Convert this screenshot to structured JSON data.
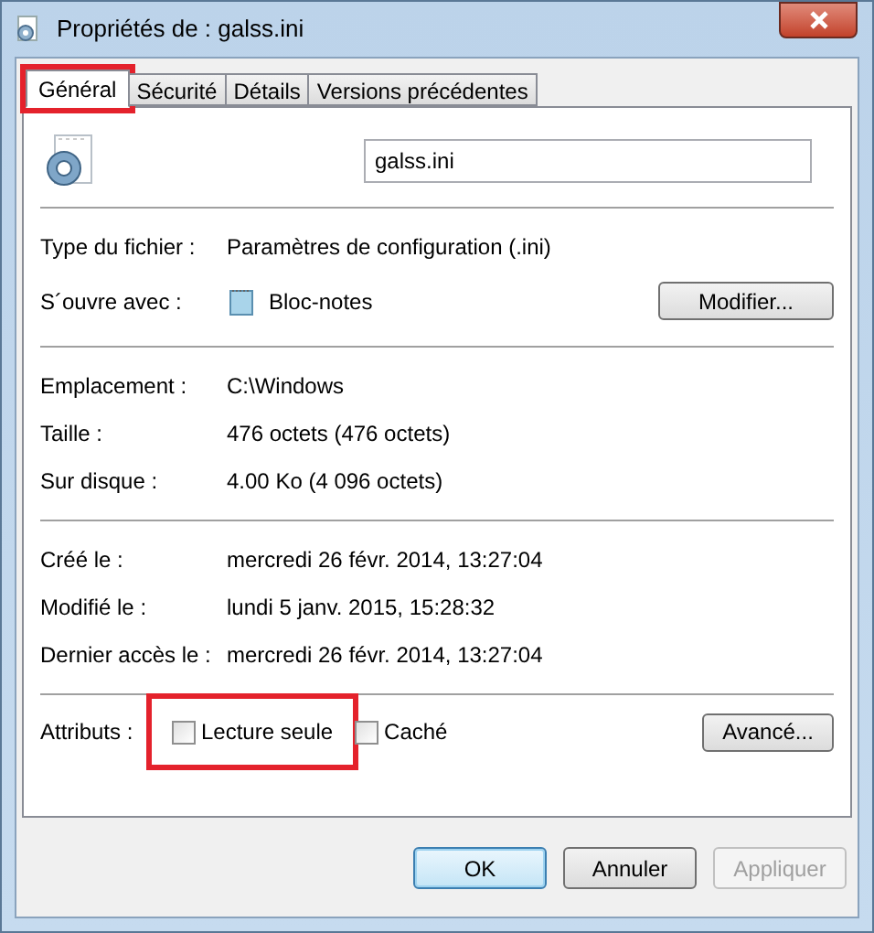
{
  "window": {
    "title": "Propriétés de : galss.ini"
  },
  "tabs": [
    {
      "label": "Général",
      "selected": true,
      "highlight": true
    },
    {
      "label": "Sécurité",
      "selected": false,
      "highlight": false
    },
    {
      "label": "Détails",
      "selected": false,
      "highlight": false
    },
    {
      "label": "Versions précédentes",
      "selected": false,
      "highlight": false
    }
  ],
  "file_name": "galss.ini",
  "groups": [
    [
      {
        "label": "Type du fichier :",
        "value": "Paramètres de configuration (.ini)"
      },
      {
        "label": "S´ouvre avec :",
        "value": "Bloc-notes",
        "kind": "app",
        "button": "Modifier..."
      }
    ],
    [
      {
        "label": "Emplacement :",
        "value": "C:\\Windows"
      },
      {
        "label": "Taille :",
        "value": "476 octets (476 octets)"
      },
      {
        "label": "Sur disque :",
        "value": "4.00 Ko (4 096 octets)"
      }
    ],
    [
      {
        "label": "Créé le :",
        "value": "mercredi 26 févr. 2014, 13:27:04"
      },
      {
        "label": "Modifié le :",
        "value": "lundi 5 janv. 2015, 15:28:32"
      },
      {
        "label": "Dernier accès le :",
        "value": "mercredi 26 févr. 2014, 13:27:04"
      }
    ]
  ],
  "attributes": {
    "label": "Attributs :",
    "options": [
      {
        "label": "Lecture seule",
        "checked": false,
        "highlight": true
      },
      {
        "label": "Caché",
        "checked": false,
        "highlight": false
      }
    ],
    "button": "Avancé..."
  },
  "buttons": [
    {
      "label": "OK",
      "default": true,
      "disabled": false
    },
    {
      "label": "Annuler",
      "default": false,
      "disabled": false
    },
    {
      "label": "Appliquer",
      "default": false,
      "disabled": true
    }
  ]
}
